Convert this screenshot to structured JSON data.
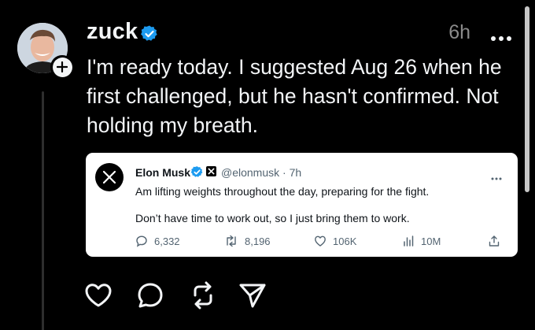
{
  "post": {
    "username": "zuck",
    "time": "6h",
    "text": "I'm ready today. I suggested Aug 26 when he first challenged, but he hasn't confirmed. Not holding my breath."
  },
  "quote": {
    "name": "Elon Musk",
    "handle": "@elonmusk · 7h",
    "line1": "Am lifting weights throughout the day, preparing for the fight.",
    "line2": "Don’t have time to work out, so I just bring them to work.",
    "replies": "6,332",
    "reposts": "8,196",
    "likes": "106K",
    "views": "10M"
  },
  "colors": {
    "background": "#000000",
    "text": "#f3f5f7",
    "muted": "#8a8a8a",
    "verified": "#1d9bf0",
    "card": "#ffffff"
  },
  "icons": [
    "verified-badge-icon",
    "more-icon",
    "plus-icon",
    "x-logo-icon",
    "reply-icon",
    "repost-icon",
    "like-icon",
    "views-icon",
    "share-icon",
    "heart-icon",
    "comment-icon",
    "send-icon"
  ]
}
